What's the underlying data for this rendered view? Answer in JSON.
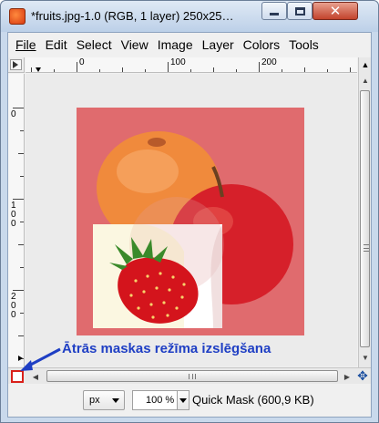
{
  "window": {
    "title": "*fruits.jpg-1.0 (RGB, 1 layer) 250x25…",
    "minimize_icon": "minimize-icon",
    "maximize_icon": "maximize-icon",
    "close_icon": "close-icon"
  },
  "menubar": {
    "items": [
      "File",
      "Edit",
      "Select",
      "View",
      "Image",
      "Layer",
      "Colors",
      "Tools"
    ]
  },
  "rulers": {
    "horizontal_labels": [
      "0",
      "100",
      "200"
    ],
    "vertical_labels": [
      "0",
      "100",
      "200"
    ]
  },
  "statusbar": {
    "unit": "px",
    "zoom": "100 %",
    "status_text": "Quick Mask (600,9 KB)"
  },
  "annotation": {
    "text": "Ātrās maskas režīma izslēgšana",
    "color": "#1f3fc4"
  },
  "colors": {
    "quick_mask_tint": "#e06b6e",
    "quick_mask_button": "#d9201a"
  }
}
